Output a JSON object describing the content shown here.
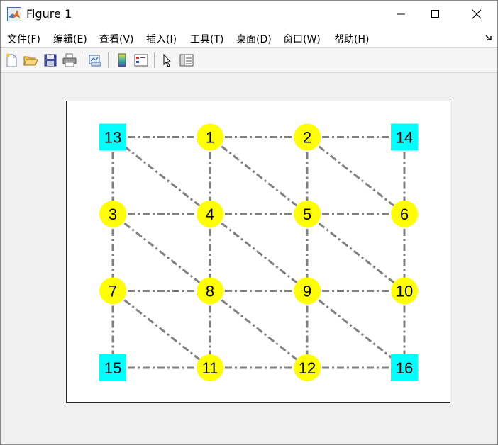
{
  "window": {
    "title": "Figure 1",
    "icon": "matlab-logo-icon"
  },
  "menu": {
    "items": [
      "文件(F)",
      "编辑(E)",
      "查看(V)",
      "插入(I)",
      "工具(T)",
      "桌面(D)",
      "窗口(W)",
      "帮助(H)"
    ]
  },
  "toolbar": {
    "tools": [
      "new-figure-icon",
      "open-file-icon",
      "save-icon",
      "print-icon",
      "link-plot-icon",
      "colorbar-icon",
      "legend-icon",
      "pointer-icon",
      "property-inspector-icon"
    ]
  },
  "colors": {
    "node_round": "#ffff00",
    "node_square": "#00ffff",
    "edge": "#808080"
  },
  "chart_data": {
    "type": "scatter",
    "title": "",
    "xlabel": "",
    "ylabel": "",
    "xlim": [
      0.6,
      4.4
    ],
    "ylim": [
      0.6,
      4.4
    ],
    "nodes": [
      {
        "id": "1",
        "x": 2,
        "y": 4,
        "marker": "circle"
      },
      {
        "id": "2",
        "x": 3,
        "y": 4,
        "marker": "circle"
      },
      {
        "id": "3",
        "x": 1,
        "y": 3,
        "marker": "circle"
      },
      {
        "id": "4",
        "x": 2,
        "y": 3,
        "marker": "circle"
      },
      {
        "id": "5",
        "x": 3,
        "y": 3,
        "marker": "circle"
      },
      {
        "id": "6",
        "x": 4,
        "y": 3,
        "marker": "circle"
      },
      {
        "id": "7",
        "x": 1,
        "y": 2,
        "marker": "circle"
      },
      {
        "id": "8",
        "x": 2,
        "y": 2,
        "marker": "circle"
      },
      {
        "id": "9",
        "x": 3,
        "y": 2,
        "marker": "circle"
      },
      {
        "id": "10",
        "x": 4,
        "y": 2,
        "marker": "circle"
      },
      {
        "id": "11",
        "x": 2,
        "y": 1,
        "marker": "circle"
      },
      {
        "id": "12",
        "x": 3,
        "y": 1,
        "marker": "circle"
      },
      {
        "id": "13",
        "x": 1,
        "y": 4,
        "marker": "square"
      },
      {
        "id": "14",
        "x": 4,
        "y": 4,
        "marker": "square"
      },
      {
        "id": "15",
        "x": 1,
        "y": 1,
        "marker": "square"
      },
      {
        "id": "16",
        "x": 4,
        "y": 1,
        "marker": "square"
      }
    ],
    "edges": [
      [
        "13",
        "1"
      ],
      [
        "1",
        "2"
      ],
      [
        "2",
        "14"
      ],
      [
        "3",
        "4"
      ],
      [
        "4",
        "5"
      ],
      [
        "5",
        "6"
      ],
      [
        "7",
        "8"
      ],
      [
        "8",
        "9"
      ],
      [
        "9",
        "10"
      ],
      [
        "15",
        "11"
      ],
      [
        "11",
        "12"
      ],
      [
        "12",
        "16"
      ],
      [
        "13",
        "3"
      ],
      [
        "3",
        "7"
      ],
      [
        "7",
        "15"
      ],
      [
        "1",
        "4"
      ],
      [
        "4",
        "8"
      ],
      [
        "8",
        "11"
      ],
      [
        "2",
        "5"
      ],
      [
        "5",
        "9"
      ],
      [
        "9",
        "12"
      ],
      [
        "14",
        "6"
      ],
      [
        "6",
        "10"
      ],
      [
        "10",
        "16"
      ],
      [
        "13",
        "4"
      ],
      [
        "1",
        "5"
      ],
      [
        "2",
        "6"
      ],
      [
        "3",
        "8"
      ],
      [
        "4",
        "9"
      ],
      [
        "5",
        "10"
      ],
      [
        "7",
        "11"
      ],
      [
        "8",
        "12"
      ],
      [
        "9",
        "16"
      ]
    ]
  }
}
